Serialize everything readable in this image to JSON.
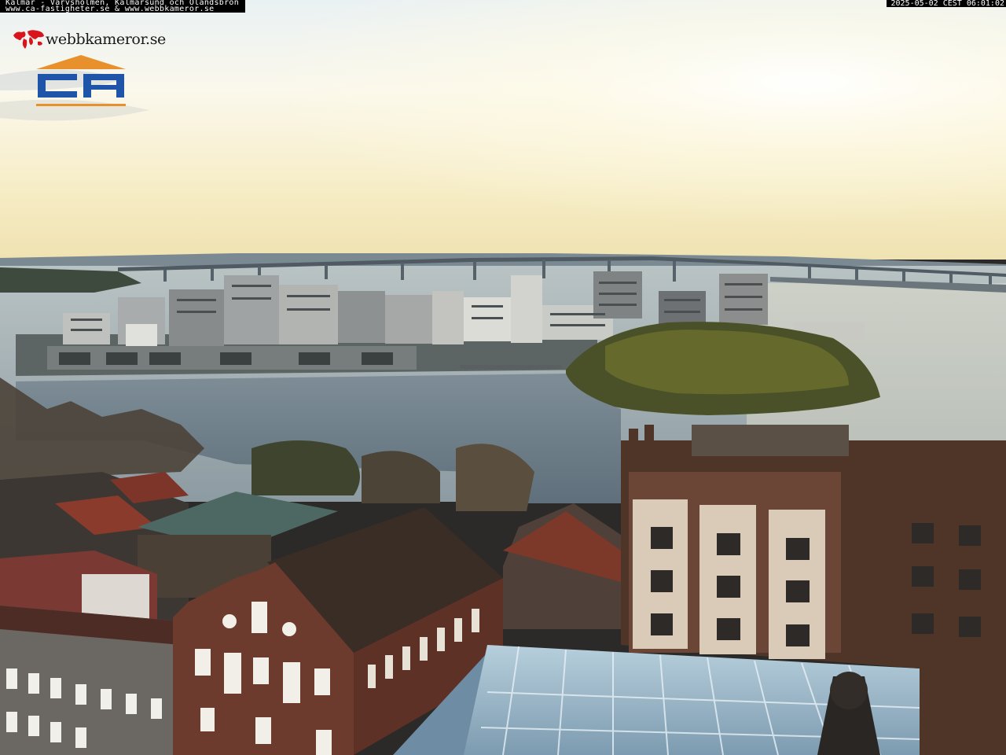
{
  "overlay": {
    "caption_line1": "Kalmar - Varvsholmen, Kalmarsund och Ölandsbron",
    "caption_line2": "www.ca-fastigheter.se & www.webbkameror.se",
    "timestamp": "2025-05-02 CEST 06:01:02"
  },
  "logos": {
    "webbkameror_text": "webbkameror.se",
    "ca_text": "CA"
  },
  "colors": {
    "ca_blue": "#1f55a8",
    "ca_orange": "#e8912c",
    "webbkameror_red": "#d8141c"
  }
}
